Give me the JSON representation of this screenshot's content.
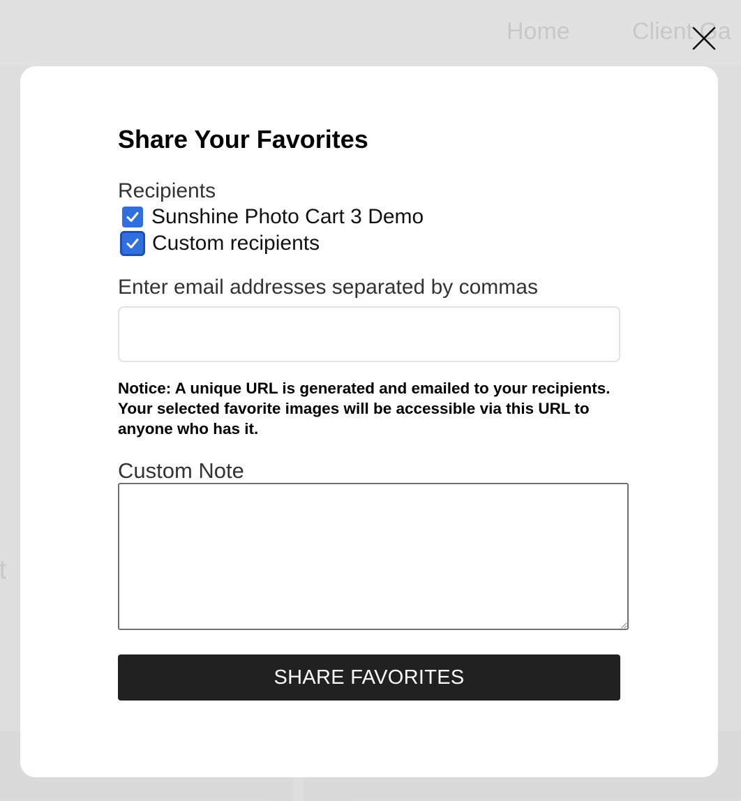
{
  "background": {
    "nav": {
      "home": "Home",
      "clients": "Client Ga"
    },
    "side_text": "rt"
  },
  "modal": {
    "title": "Share Your Favorites",
    "recipients_label": "Recipients",
    "recipients": [
      {
        "label": "Sunshine Photo Cart 3 Demo",
        "checked": true
      },
      {
        "label": "Custom recipients",
        "checked": true
      }
    ],
    "email_label": "Enter email addresses separated by commas",
    "email_value": "",
    "notice": "Notice: A unique URL is generated and emailed to your recipients. Your selected favorite images will be accessible via this URL to anyone who has it.",
    "custom_note_label": "Custom Note",
    "custom_note_value": "",
    "share_button_label": "SHARE FAVORITES"
  },
  "colors": {
    "accent_checkbox": "#2f6fde",
    "button_bg": "#212121",
    "button_text": "#ffffff"
  },
  "icons": {
    "close": "close-icon",
    "check": "check-icon"
  }
}
